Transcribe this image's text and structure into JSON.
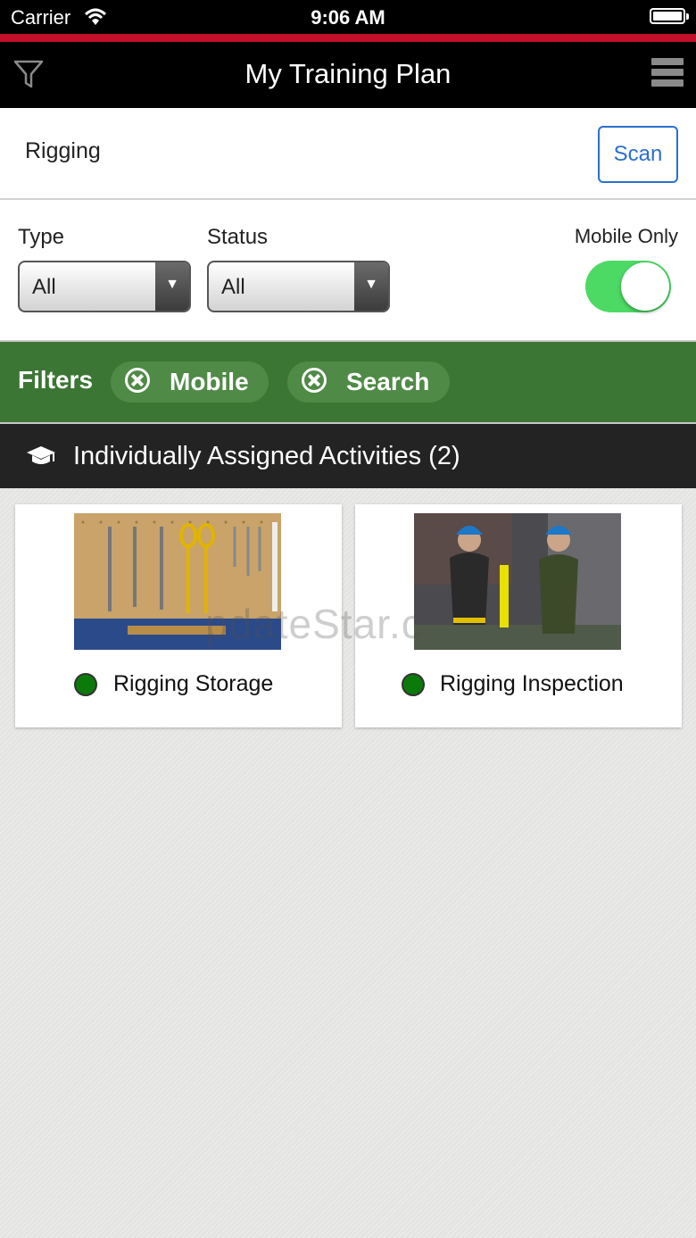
{
  "status_bar": {
    "carrier": "Carrier",
    "time": "9:06 AM"
  },
  "nav": {
    "title": "My Training Plan",
    "filter_icon": "funnel-icon",
    "menu_icon": "hamburger-menu-icon"
  },
  "search": {
    "value": "Rigging",
    "scan_label": "Scan"
  },
  "filters": {
    "type_label": "Type",
    "type_value": "All",
    "status_label": "Status",
    "status_value": "All",
    "mobile_only_label": "Mobile Only",
    "mobile_only_on": true
  },
  "active_filters": {
    "label": "Filters",
    "chips": [
      {
        "label": "Mobile"
      },
      {
        "label": "Search"
      }
    ]
  },
  "section": {
    "title": "Individually Assigned Activities (2)",
    "icon": "graduation-cap-icon"
  },
  "activities": [
    {
      "title": "Rigging Storage",
      "status_color": "#0b7a0b"
    },
    {
      "title": "Rigging Inspection",
      "status_color": "#0b7a0b"
    }
  ],
  "watermark": "pdateStar.c",
  "colors": {
    "accent_red": "#c3102a",
    "filters_green": "#3c7634",
    "toggle_green": "#4cd964",
    "link_blue": "#2a6fd1"
  }
}
